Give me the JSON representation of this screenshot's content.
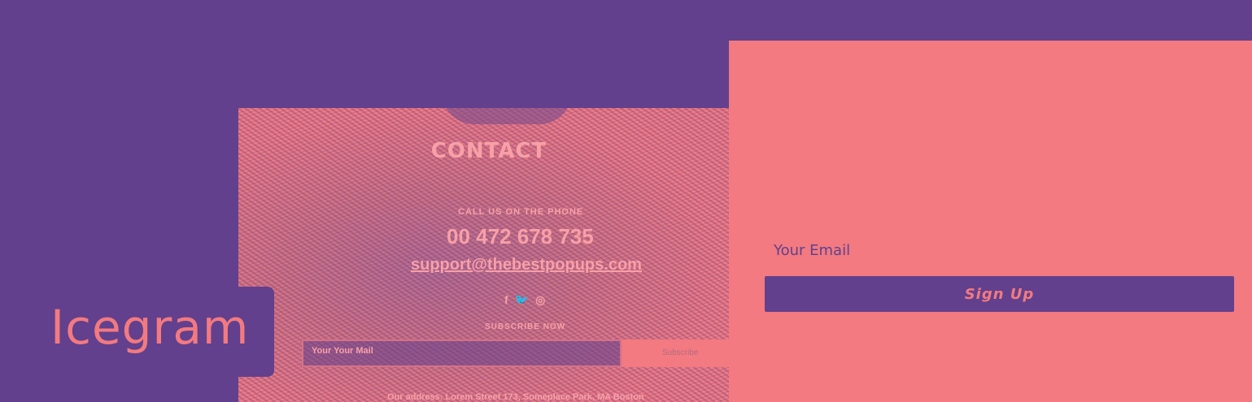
{
  "brand": {
    "logo_text": "Icegram"
  },
  "contact_card": {
    "title": "CONTACT",
    "subtitle": "CALL US ON THE PHONE",
    "phone": "00 472 678 735",
    "email": "support@thebestpopups.com",
    "social_icons": [
      "facebook-icon",
      "twitter-icon",
      "instagram-icon"
    ],
    "social_glyphs": {
      "facebook": "f",
      "twitter": "🐦",
      "instagram": "◎"
    },
    "subscribe_label": "SUBSCRIBE NOW",
    "input_placeholder": "Your Your Mail",
    "button_label": "Subscribe",
    "address": "Our address: Lorem Street 173, Someplace Park, MA Boston"
  },
  "signup": {
    "email_placeholder": "Your Email",
    "button_label": "Sign Up"
  },
  "colors": {
    "purple": "#62408d",
    "coral": "#f27a80"
  }
}
